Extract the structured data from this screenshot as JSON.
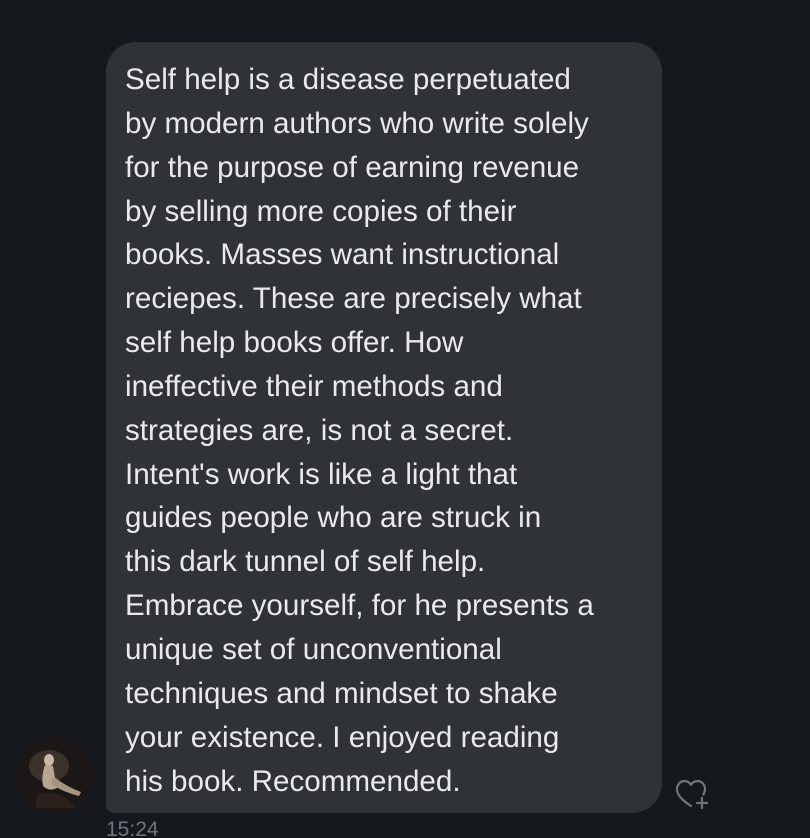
{
  "conversation": {
    "message": {
      "text": "Self help is a disease perpetuated\nby modern authors who write solely\nfor the purpose of earning revenue\nby selling more copies of their\nbooks. Masses want instructional\nreciepes. These are precisely what\nself help books offer. How\nineffective their methods and\nstrategies are, is not a secret.\nIntent's work is like a light that\nguides people who are struck in\nthis dark tunnel of self help.\nEmbrace yourself, for he presents a\nunique set of unconventional\ntechniques and mindset to shake\nyour existence.  I enjoyed reading\nhis book. Recommended.",
      "timestamp": "15:24",
      "reaction_icon": "heart-plus-icon",
      "sender_avatar_icon": "sender-avatar"
    }
  },
  "colors": {
    "background": "#15181d",
    "bubble": "#2f3336",
    "text": "#e8eaec",
    "muted": "#6e767d"
  }
}
